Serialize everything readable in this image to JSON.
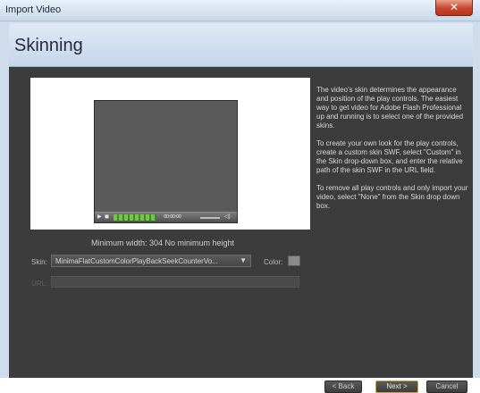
{
  "window": {
    "title": "Import Video",
    "close_label": "✕"
  },
  "header": {
    "title": "Skinning"
  },
  "preview": {
    "player": {
      "play_icon": "▶",
      "stop_icon": "◼",
      "counter": "00:00:00",
      "volume_icon": "◁)"
    },
    "min_size_text": "Minimum width: 304   No minimum height"
  },
  "form": {
    "skin_label": "Skin:",
    "skin_value": "MinimaFlatCustomColorPlayBackSeekCounterVo...",
    "dropdown_arrow": "▼",
    "color_label": "Color:",
    "url_label": "URL:",
    "url_value": ""
  },
  "help": {
    "paragraphs": [
      "The video's skin determines the appearance and position of the play controls. The easiest way to get video for Adobe Flash Professional up and running is to select one of the provided skins.",
      "To create your own look for the play controls, create a custom skin SWF, select \"Custom\" in the Skin drop-down box, and enter the relative path of the skin SWF in the URL field.",
      "To remove all play controls and only import your video, select \"None\" from the Skin drop down box."
    ]
  },
  "buttons": {
    "back": "< Back",
    "next": "Next >",
    "cancel": "Cancel"
  },
  "colors": {
    "accent_next_border": "#c9a43a",
    "panel_bg": "#3c3c3c",
    "header_bg": "#c5d6ea"
  }
}
